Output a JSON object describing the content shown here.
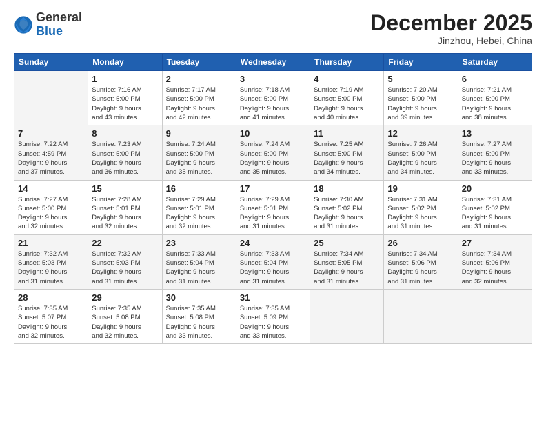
{
  "logo": {
    "general": "General",
    "blue": "Blue"
  },
  "title": {
    "month": "December 2025",
    "location": "Jinzhou, Hebei, China"
  },
  "weekdays": [
    "Sunday",
    "Monday",
    "Tuesday",
    "Wednesday",
    "Thursday",
    "Friday",
    "Saturday"
  ],
  "weeks": [
    [
      {
        "day": "",
        "info": ""
      },
      {
        "day": "1",
        "info": "Sunrise: 7:16 AM\nSunset: 5:00 PM\nDaylight: 9 hours\nand 43 minutes."
      },
      {
        "day": "2",
        "info": "Sunrise: 7:17 AM\nSunset: 5:00 PM\nDaylight: 9 hours\nand 42 minutes."
      },
      {
        "day": "3",
        "info": "Sunrise: 7:18 AM\nSunset: 5:00 PM\nDaylight: 9 hours\nand 41 minutes."
      },
      {
        "day": "4",
        "info": "Sunrise: 7:19 AM\nSunset: 5:00 PM\nDaylight: 9 hours\nand 40 minutes."
      },
      {
        "day": "5",
        "info": "Sunrise: 7:20 AM\nSunset: 5:00 PM\nDaylight: 9 hours\nand 39 minutes."
      },
      {
        "day": "6",
        "info": "Sunrise: 7:21 AM\nSunset: 5:00 PM\nDaylight: 9 hours\nand 38 minutes."
      }
    ],
    [
      {
        "day": "7",
        "info": "Sunrise: 7:22 AM\nSunset: 4:59 PM\nDaylight: 9 hours\nand 37 minutes."
      },
      {
        "day": "8",
        "info": "Sunrise: 7:23 AM\nSunset: 5:00 PM\nDaylight: 9 hours\nand 36 minutes."
      },
      {
        "day": "9",
        "info": "Sunrise: 7:24 AM\nSunset: 5:00 PM\nDaylight: 9 hours\nand 35 minutes."
      },
      {
        "day": "10",
        "info": "Sunrise: 7:24 AM\nSunset: 5:00 PM\nDaylight: 9 hours\nand 35 minutes."
      },
      {
        "day": "11",
        "info": "Sunrise: 7:25 AM\nSunset: 5:00 PM\nDaylight: 9 hours\nand 34 minutes."
      },
      {
        "day": "12",
        "info": "Sunrise: 7:26 AM\nSunset: 5:00 PM\nDaylight: 9 hours\nand 34 minutes."
      },
      {
        "day": "13",
        "info": "Sunrise: 7:27 AM\nSunset: 5:00 PM\nDaylight: 9 hours\nand 33 minutes."
      }
    ],
    [
      {
        "day": "14",
        "info": "Sunrise: 7:27 AM\nSunset: 5:00 PM\nDaylight: 9 hours\nand 32 minutes."
      },
      {
        "day": "15",
        "info": "Sunrise: 7:28 AM\nSunset: 5:01 PM\nDaylight: 9 hours\nand 32 minutes."
      },
      {
        "day": "16",
        "info": "Sunrise: 7:29 AM\nSunset: 5:01 PM\nDaylight: 9 hours\nand 32 minutes."
      },
      {
        "day": "17",
        "info": "Sunrise: 7:29 AM\nSunset: 5:01 PM\nDaylight: 9 hours\nand 31 minutes."
      },
      {
        "day": "18",
        "info": "Sunrise: 7:30 AM\nSunset: 5:02 PM\nDaylight: 9 hours\nand 31 minutes."
      },
      {
        "day": "19",
        "info": "Sunrise: 7:31 AM\nSunset: 5:02 PM\nDaylight: 9 hours\nand 31 minutes."
      },
      {
        "day": "20",
        "info": "Sunrise: 7:31 AM\nSunset: 5:02 PM\nDaylight: 9 hours\nand 31 minutes."
      }
    ],
    [
      {
        "day": "21",
        "info": "Sunrise: 7:32 AM\nSunset: 5:03 PM\nDaylight: 9 hours\nand 31 minutes."
      },
      {
        "day": "22",
        "info": "Sunrise: 7:32 AM\nSunset: 5:03 PM\nDaylight: 9 hours\nand 31 minutes."
      },
      {
        "day": "23",
        "info": "Sunrise: 7:33 AM\nSunset: 5:04 PM\nDaylight: 9 hours\nand 31 minutes."
      },
      {
        "day": "24",
        "info": "Sunrise: 7:33 AM\nSunset: 5:04 PM\nDaylight: 9 hours\nand 31 minutes."
      },
      {
        "day": "25",
        "info": "Sunrise: 7:34 AM\nSunset: 5:05 PM\nDaylight: 9 hours\nand 31 minutes."
      },
      {
        "day": "26",
        "info": "Sunrise: 7:34 AM\nSunset: 5:06 PM\nDaylight: 9 hours\nand 31 minutes."
      },
      {
        "day": "27",
        "info": "Sunrise: 7:34 AM\nSunset: 5:06 PM\nDaylight: 9 hours\nand 32 minutes."
      }
    ],
    [
      {
        "day": "28",
        "info": "Sunrise: 7:35 AM\nSunset: 5:07 PM\nDaylight: 9 hours\nand 32 minutes."
      },
      {
        "day": "29",
        "info": "Sunrise: 7:35 AM\nSunset: 5:08 PM\nDaylight: 9 hours\nand 32 minutes."
      },
      {
        "day": "30",
        "info": "Sunrise: 7:35 AM\nSunset: 5:08 PM\nDaylight: 9 hours\nand 33 minutes."
      },
      {
        "day": "31",
        "info": "Sunrise: 7:35 AM\nSunset: 5:09 PM\nDaylight: 9 hours\nand 33 minutes."
      },
      {
        "day": "",
        "info": ""
      },
      {
        "day": "",
        "info": ""
      },
      {
        "day": "",
        "info": ""
      }
    ]
  ]
}
